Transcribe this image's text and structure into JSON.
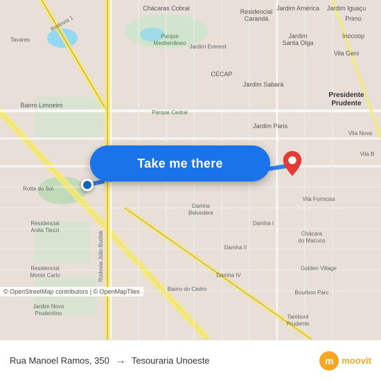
{
  "map": {
    "attribution": "© OpenStreetMap contributors | © OpenMapTiles",
    "background_color": "#e8e0d8"
  },
  "button": {
    "label": "Take me there"
  },
  "bottom_bar": {
    "origin": "Rua Manoel Ramos, 350",
    "arrow": "→",
    "destination": "Tesouraria Unoeste",
    "logo_letter": "m",
    "logo_text": "moovit"
  },
  "labels": {
    "chacaras_cobral": "Chácaras Cobral",
    "residencial_caranda": "Residencial Carandá",
    "jardim_america": "Jardim América",
    "jardim_iguacu": "Jardim Iguaçu",
    "inocoop": "Inocoop",
    "jardim_santa_olga": "Jardim Santa Olga",
    "vila_geni": "Vila Geni",
    "parque_mediterraneo": "Parque Mediterrâneo",
    "jardim_everest": "Jardim Everest",
    "cecap": "CECAP",
    "jardim_sabara": "Jardim Sabará",
    "presidente_prudente": "Presidente Prudente",
    "parque_cedral": "Parque Cedral",
    "jardim_paris": "Jardim Paris",
    "bairro_limoeiro": "Bairro Limoeiro",
    "rotta_do_sol": "Rotta do Sol",
    "damha_belvedere": "Damha Belvedere",
    "damha_i": "Damha I",
    "damha_ii": "Damha II",
    "damha_iv": "Damha IV",
    "bairro_do_cedro": "Bairro do Cedro",
    "chacara_do_macuco": "Chácara do Macuco",
    "golden_village": "Golden Village",
    "bourbon_parc": "Bourbon Parc",
    "tambore_prudente": "Tamboré Prudente",
    "residencial_anita_tiezzi": "Residencial Anita Tiezzi",
    "residencial_monte_carlo": "Residencial Monte Carlo",
    "jardim_novo_prudentino": "Jardim Novo Prudentino",
    "vila_formosa": "Vila Formosa",
    "rodovia_julio_budisk": "Rodovia Júlio Budisk",
    "rodovia_1": "Rodovia 1",
    "tavares": "Tavares",
    "vila_nova": "Vila Nova",
    "vila_b": "Vila B"
  }
}
